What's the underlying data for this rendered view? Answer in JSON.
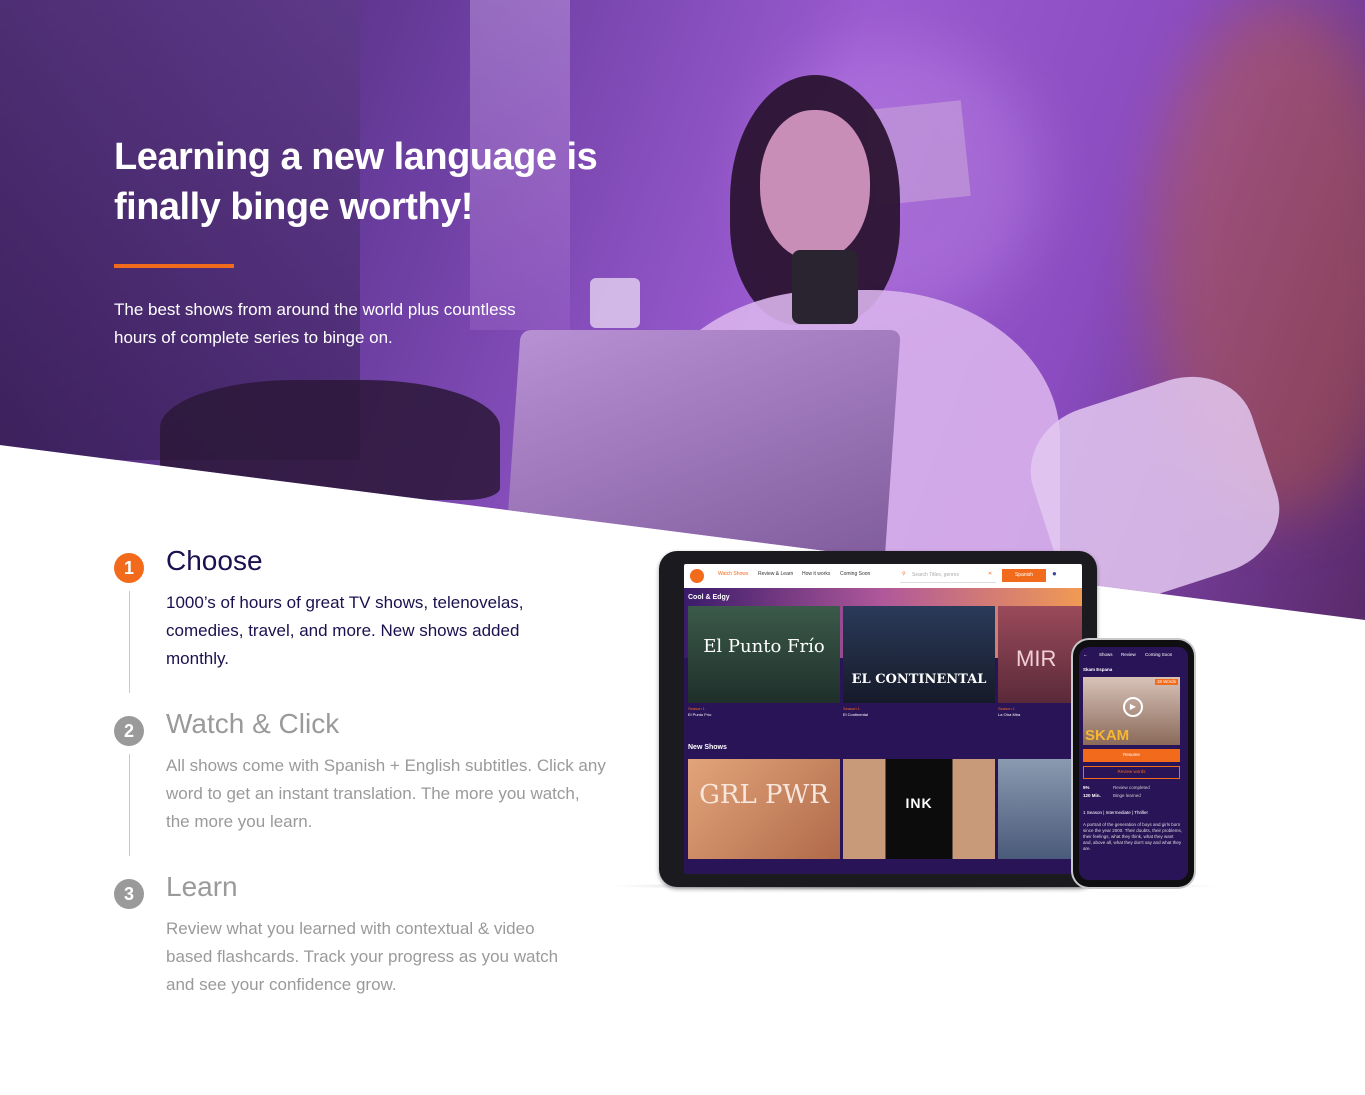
{
  "hero": {
    "title": "Learning a new language is finally binge worthy!",
    "subtitle": "The best shows from around the world plus countless hours of complete series to binge on."
  },
  "steps": [
    {
      "number": "1",
      "title": "Choose",
      "text": "1000’s of hours of great TV shows, telenovelas, comedies, travel, and more. New shows added monthly."
    },
    {
      "number": "2",
      "title": "Watch & Click",
      "text": "All shows come with Spanish + English subtitles. Click any word to get an instant translation. The more you watch, the more you learn."
    },
    {
      "number": "3",
      "title": "Learn",
      "text": "Review what you learned with contextual & video based flashcards. Track your progress as you watch and see your confidence grow."
    }
  ],
  "tablet_app": {
    "nav": [
      "Watch Shows",
      "Review & Learn",
      "How it works",
      "Coming Soon"
    ],
    "search_placeholder": "Search Titles, genres",
    "language_button": "Spanish",
    "section_cool": "Cool & Edgy",
    "cool_shows": [
      {
        "season": "Season 1",
        "title": "El Punto Frío",
        "art": "El Punto Frío"
      },
      {
        "season": "Season 1",
        "title": "El Continental",
        "art": "EL CONTINENTAL"
      },
      {
        "season": "Season 1",
        "title": "La Otra Mira",
        "art": "MIR"
      }
    ],
    "section_new": "New Shows",
    "new_shows": [
      {
        "art": "GRL PWR"
      },
      {
        "art": "INK"
      },
      {
        "art": ""
      }
    ]
  },
  "phone_app": {
    "nav": [
      "Shows",
      "Review",
      "Coming Soon"
    ],
    "show_title": "Skam Espana",
    "words_badge": "18 Words",
    "poster": "SKAM",
    "resume": "Resume",
    "review_words": "Review words",
    "stat_percent": "5%",
    "stat_minutes": "120 Min.",
    "stat_review": "Review completed",
    "stat_binge": "Binge learned",
    "meta": "1 Season | Intermediate | Thriller",
    "description": "A portrait of the generation of boys and girls born since the year 2000. Their doubts, their problems, their feelings, what they think, what they want and, above all, what they don't say and what they are."
  },
  "colors": {
    "accent": "#f26b1d",
    "step_active": "#1b1050",
    "step_inactive": "#9a9a9a",
    "hero_purple": "#8a4cc0"
  }
}
